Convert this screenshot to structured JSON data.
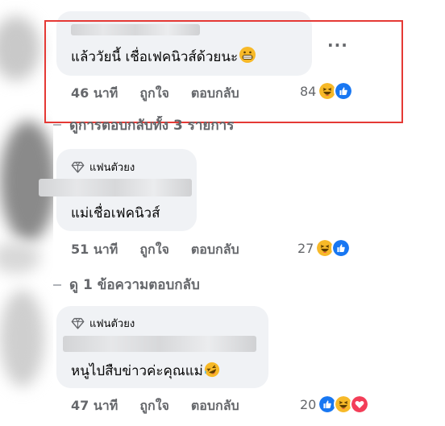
{
  "comments": [
    {
      "text": "แล้ววัยนี้ เชื่อเฟคนิวส์ด้วยนะ",
      "inline_emoji": "grinning-face-emoji",
      "time": "46 นาที",
      "like_label": "ถูกใจ",
      "reply_label": "ตอบกลับ",
      "reaction_count": "84",
      "reactions": [
        "haha",
        "like"
      ],
      "more_label": "···"
    },
    {
      "badge": "แฟนตัวยง",
      "text": "แม่เชื่อเฟคนิวส์",
      "time": "51 นาที",
      "like_label": "ถูกใจ",
      "reply_label": "ตอบกลับ",
      "reaction_count": "27",
      "reactions": [
        "haha",
        "like"
      ]
    },
    {
      "badge": "แฟนตัวยง",
      "text": "หนูไปสืบข่าวค่ะคุณแม่",
      "inline_emoji": "rolling-laughing-emoji",
      "time": "47 นาที",
      "like_label": "ถูกใจ",
      "reply_label": "ตอบกลับ",
      "reaction_count": "20",
      "reactions": [
        "like",
        "haha",
        "love"
      ]
    }
  ],
  "view_replies": [
    "ดูการตอบกลับทั้ง 3 รายการ",
    "ดู 1 ข้อความตอบกลับ"
  ],
  "colors": {
    "bubble": "#f0f2f5",
    "meta_text": "#65676b",
    "like_blue": "#1877f2",
    "love_red": "#f33e58",
    "haha_yellow": "#f7b928",
    "highlight": "#e53935"
  }
}
